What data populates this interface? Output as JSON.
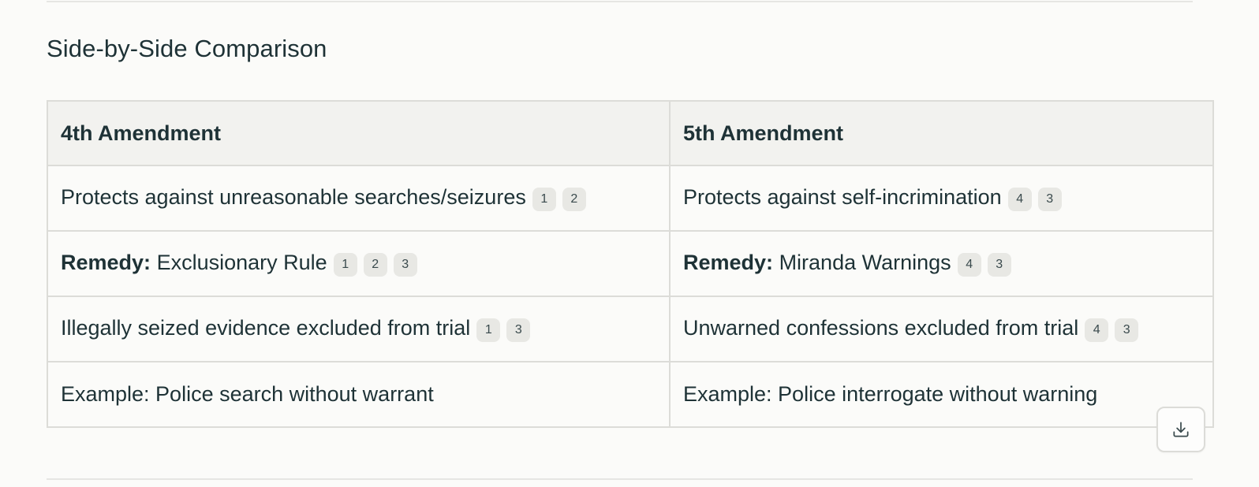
{
  "section": {
    "title": "Side-by-Side Comparison"
  },
  "table": {
    "headers": [
      "4th Amendment",
      "5th Amendment"
    ],
    "rows": [
      {
        "left": {
          "bold": "",
          "text": "Protects against unreasonable searches/seizures",
          "cites": [
            "1",
            "2"
          ]
        },
        "right": {
          "bold": "",
          "text": "Protects against self-incrimination",
          "cites": [
            "4",
            "3"
          ]
        }
      },
      {
        "left": {
          "bold": "Remedy:",
          "text": "Exclusionary Rule",
          "cites": [
            "1",
            "2",
            "3"
          ]
        },
        "right": {
          "bold": "Remedy:",
          "text": "Miranda Warnings",
          "cites": [
            "4",
            "3"
          ]
        }
      },
      {
        "left": {
          "bold": "",
          "text": "Illegally seized evidence excluded from trial",
          "cites": [
            "1",
            "3"
          ]
        },
        "right": {
          "bold": "",
          "text": "Unwarned confessions excluded from trial",
          "cites": [
            "4",
            "3"
          ]
        }
      },
      {
        "left": {
          "bold": "",
          "text": "Example: Police search without warrant",
          "cites": []
        },
        "right": {
          "bold": "",
          "text": "Example: Police interrogate without warning",
          "cites": []
        }
      }
    ]
  },
  "download_button": {
    "icon": "download-icon"
  }
}
